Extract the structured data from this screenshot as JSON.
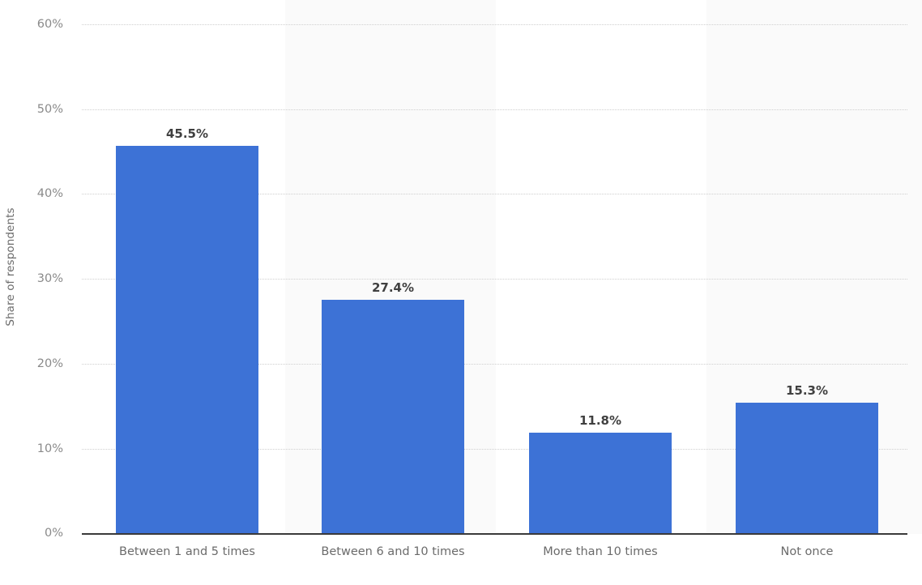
{
  "chart_data": {
    "type": "bar",
    "title": "",
    "subtitle": "",
    "xlabel": "",
    "ylabel": "Share of respondents",
    "categories": [
      "Between 1 and 5 times",
      "Between 6 and 10 times",
      "More than 10 times",
      "Not once"
    ],
    "values": [
      45.5,
      27.4,
      11.8,
      15.3
    ],
    "data_labels": [
      "45.5%",
      "27.4%",
      "11.8%",
      "15.3%"
    ],
    "ylim": [
      0,
      60
    ],
    "ytick_values": [
      0,
      10,
      20,
      30,
      40,
      50,
      60
    ],
    "ytick_labels": [
      "0%",
      "10%",
      "20%",
      "30%",
      "40%",
      "50%",
      "60%"
    ],
    "grid": "horizontal-dotted",
    "legend": "none",
    "series": [
      {
        "name": "Share of respondents",
        "values": [
          45.5,
          27.4,
          11.8,
          15.3
        ]
      }
    ],
    "colors": {
      "bar": "#3d72d6",
      "band": "#fafafa",
      "background": "#ffffff",
      "gridline": "#cfcfcf",
      "axis": "#3a3a3a",
      "tick_text": "#8a8a8a",
      "category_text": "#6b6b6b",
      "data_label_text": "#404040"
    }
  }
}
